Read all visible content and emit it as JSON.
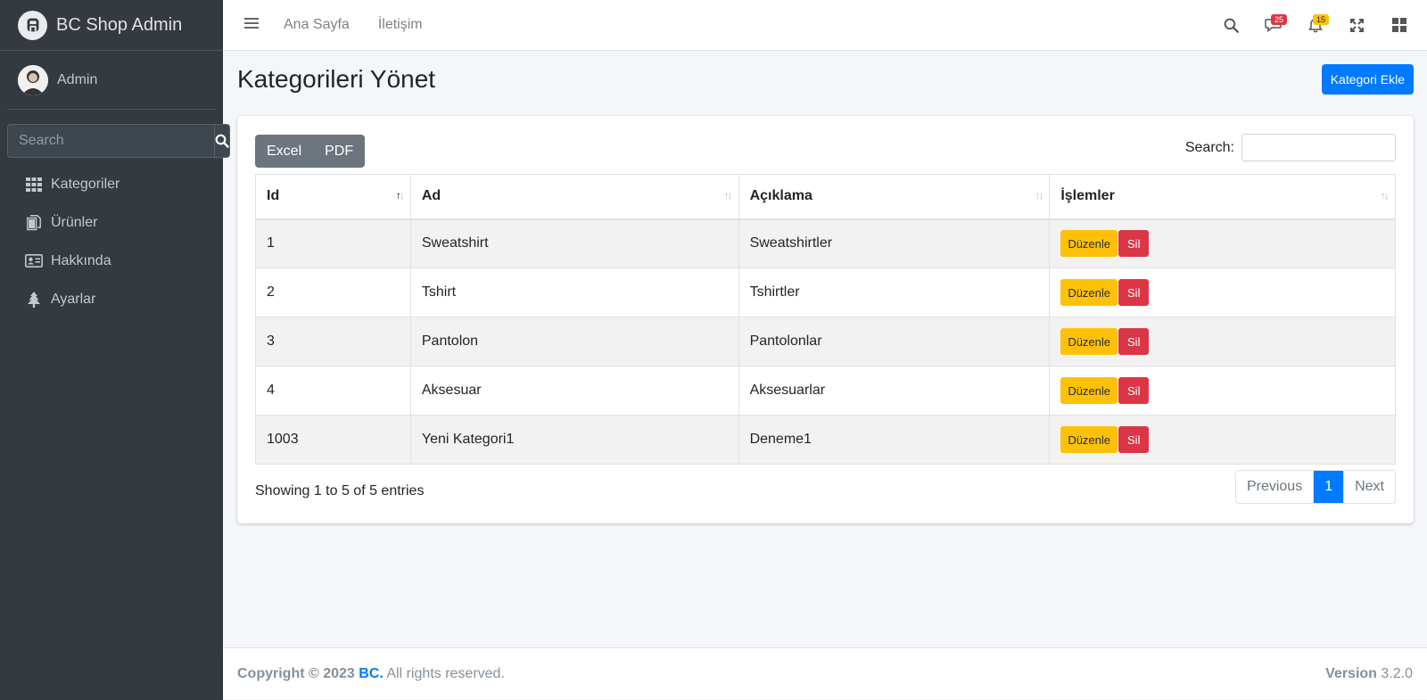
{
  "brand": {
    "name": "BC Shop Admin"
  },
  "user": {
    "name": "Admin"
  },
  "sidebar": {
    "search_placeholder": "Search",
    "items": [
      {
        "label": "Kategoriler",
        "icon": "grid-icon"
      },
      {
        "label": "Ürünler",
        "icon": "copy-icon"
      },
      {
        "label": "Hakkında",
        "icon": "id-card-icon"
      },
      {
        "label": "Ayarlar",
        "icon": "tree-icon"
      }
    ]
  },
  "topnav": {
    "links": [
      "Ana Sayfa",
      "İletişim"
    ],
    "messages_count": "25",
    "notifications_count": "15"
  },
  "page": {
    "title": "Kategorileri Yönet",
    "add_button": "Kategori Ekle"
  },
  "table": {
    "export_buttons": [
      "Excel",
      "PDF"
    ],
    "search_label": "Search:",
    "search_value": "",
    "headers": [
      "Id",
      "Ad",
      "Açıklama",
      "İşlemler"
    ],
    "rows": [
      {
        "id": "1",
        "name": "Sweatshirt",
        "description": "Sweatshirtler"
      },
      {
        "id": "2",
        "name": "Tshirt",
        "description": "Tshirtler"
      },
      {
        "id": "3",
        "name": "Pantolon",
        "description": "Pantolonlar"
      },
      {
        "id": "4",
        "name": "Aksesuar",
        "description": "Aksesuarlar"
      },
      {
        "id": "1003",
        "name": "Yeni Kategori1",
        "description": "Deneme1"
      }
    ],
    "edit_label": "Düzenle",
    "delete_label": "Sil",
    "info": "Showing 1 to 5 of 5 entries",
    "pagination": {
      "previous": "Previous",
      "current": "1",
      "next": "Next"
    }
  },
  "footer": {
    "copyright": "Copyright © 2023",
    "brand": "BC.",
    "rights": "All rights reserved.",
    "version_label": "Version",
    "version": "3.2.0"
  },
  "colors": {
    "primary": "#007bff",
    "warning": "#ffc107",
    "danger": "#dc3545",
    "sidebar": "#343a40"
  }
}
